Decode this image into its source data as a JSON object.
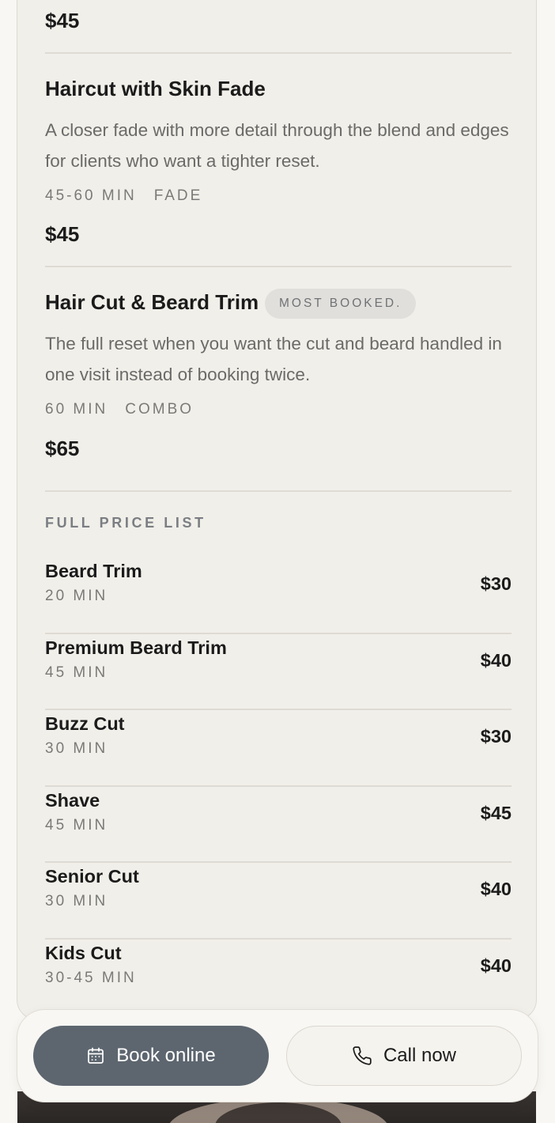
{
  "featured_services": [
    {
      "price": "$45"
    },
    {
      "title": "Haircut with Skin Fade",
      "description": "A closer fade with more detail through the blend and edges for clients who want a tighter reset.",
      "duration": "45-60 MIN",
      "tag": "FADE",
      "price": "$45"
    },
    {
      "title": "Hair Cut & Beard Trim",
      "badge": "MOST BOOKED.",
      "description": "The full reset when you want the cut and beard handled in one visit instead of booking twice.",
      "duration": "60 MIN",
      "tag": "COMBO",
      "price": "$65"
    }
  ],
  "price_list": {
    "heading": "FULL PRICE LIST",
    "items": [
      {
        "name": "Beard Trim",
        "duration": "20 MIN",
        "price": "$30"
      },
      {
        "name": "Premium Beard Trim",
        "duration": "45 MIN",
        "price": "$40"
      },
      {
        "name": "Buzz Cut",
        "duration": "30 MIN",
        "price": "$30"
      },
      {
        "name": "Shave",
        "duration": "45 MIN",
        "price": "$45"
      },
      {
        "name": "Senior Cut",
        "duration": "30 MIN",
        "price": "$40"
      },
      {
        "name": "Kids Cut",
        "duration": "30-45 MIN",
        "price": "$40"
      }
    ]
  },
  "actions": {
    "book_label": "Book online",
    "book_icon": "calendar-icon",
    "call_label": "Call now",
    "call_icon": "phone-icon"
  },
  "colors": {
    "primary_button": "#5d666f",
    "card_background": "#f1efe9",
    "page_background": "#f8f7f3"
  }
}
